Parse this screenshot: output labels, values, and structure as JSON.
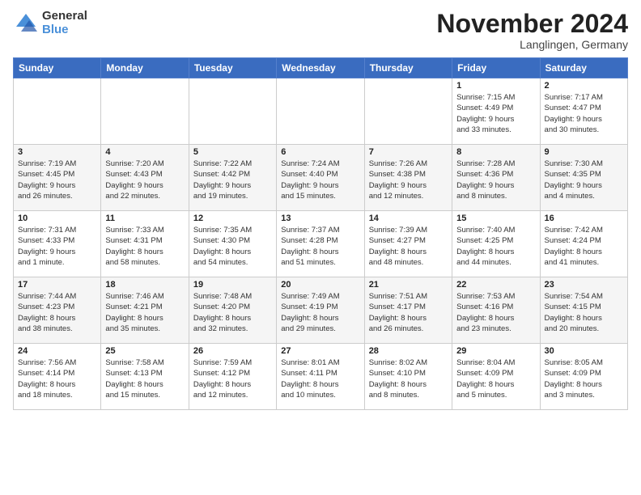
{
  "logo": {
    "general": "General",
    "blue": "Blue"
  },
  "title": "November 2024",
  "location": "Langlingen, Germany",
  "days_header": [
    "Sunday",
    "Monday",
    "Tuesday",
    "Wednesday",
    "Thursday",
    "Friday",
    "Saturday"
  ],
  "weeks": [
    [
      {
        "day": "",
        "info": ""
      },
      {
        "day": "",
        "info": ""
      },
      {
        "day": "",
        "info": ""
      },
      {
        "day": "",
        "info": ""
      },
      {
        "day": "",
        "info": ""
      },
      {
        "day": "1",
        "info": "Sunrise: 7:15 AM\nSunset: 4:49 PM\nDaylight: 9 hours\nand 33 minutes."
      },
      {
        "day": "2",
        "info": "Sunrise: 7:17 AM\nSunset: 4:47 PM\nDaylight: 9 hours\nand 30 minutes."
      }
    ],
    [
      {
        "day": "3",
        "info": "Sunrise: 7:19 AM\nSunset: 4:45 PM\nDaylight: 9 hours\nand 26 minutes."
      },
      {
        "day": "4",
        "info": "Sunrise: 7:20 AM\nSunset: 4:43 PM\nDaylight: 9 hours\nand 22 minutes."
      },
      {
        "day": "5",
        "info": "Sunrise: 7:22 AM\nSunset: 4:42 PM\nDaylight: 9 hours\nand 19 minutes."
      },
      {
        "day": "6",
        "info": "Sunrise: 7:24 AM\nSunset: 4:40 PM\nDaylight: 9 hours\nand 15 minutes."
      },
      {
        "day": "7",
        "info": "Sunrise: 7:26 AM\nSunset: 4:38 PM\nDaylight: 9 hours\nand 12 minutes."
      },
      {
        "day": "8",
        "info": "Sunrise: 7:28 AM\nSunset: 4:36 PM\nDaylight: 9 hours\nand 8 minutes."
      },
      {
        "day": "9",
        "info": "Sunrise: 7:30 AM\nSunset: 4:35 PM\nDaylight: 9 hours\nand 4 minutes."
      }
    ],
    [
      {
        "day": "10",
        "info": "Sunrise: 7:31 AM\nSunset: 4:33 PM\nDaylight: 9 hours\nand 1 minute."
      },
      {
        "day": "11",
        "info": "Sunrise: 7:33 AM\nSunset: 4:31 PM\nDaylight: 8 hours\nand 58 minutes."
      },
      {
        "day": "12",
        "info": "Sunrise: 7:35 AM\nSunset: 4:30 PM\nDaylight: 8 hours\nand 54 minutes."
      },
      {
        "day": "13",
        "info": "Sunrise: 7:37 AM\nSunset: 4:28 PM\nDaylight: 8 hours\nand 51 minutes."
      },
      {
        "day": "14",
        "info": "Sunrise: 7:39 AM\nSunset: 4:27 PM\nDaylight: 8 hours\nand 48 minutes."
      },
      {
        "day": "15",
        "info": "Sunrise: 7:40 AM\nSunset: 4:25 PM\nDaylight: 8 hours\nand 44 minutes."
      },
      {
        "day": "16",
        "info": "Sunrise: 7:42 AM\nSunset: 4:24 PM\nDaylight: 8 hours\nand 41 minutes."
      }
    ],
    [
      {
        "day": "17",
        "info": "Sunrise: 7:44 AM\nSunset: 4:23 PM\nDaylight: 8 hours\nand 38 minutes."
      },
      {
        "day": "18",
        "info": "Sunrise: 7:46 AM\nSunset: 4:21 PM\nDaylight: 8 hours\nand 35 minutes."
      },
      {
        "day": "19",
        "info": "Sunrise: 7:48 AM\nSunset: 4:20 PM\nDaylight: 8 hours\nand 32 minutes."
      },
      {
        "day": "20",
        "info": "Sunrise: 7:49 AM\nSunset: 4:19 PM\nDaylight: 8 hours\nand 29 minutes."
      },
      {
        "day": "21",
        "info": "Sunrise: 7:51 AM\nSunset: 4:17 PM\nDaylight: 8 hours\nand 26 minutes."
      },
      {
        "day": "22",
        "info": "Sunrise: 7:53 AM\nSunset: 4:16 PM\nDaylight: 8 hours\nand 23 minutes."
      },
      {
        "day": "23",
        "info": "Sunrise: 7:54 AM\nSunset: 4:15 PM\nDaylight: 8 hours\nand 20 minutes."
      }
    ],
    [
      {
        "day": "24",
        "info": "Sunrise: 7:56 AM\nSunset: 4:14 PM\nDaylight: 8 hours\nand 18 minutes."
      },
      {
        "day": "25",
        "info": "Sunrise: 7:58 AM\nSunset: 4:13 PM\nDaylight: 8 hours\nand 15 minutes."
      },
      {
        "day": "26",
        "info": "Sunrise: 7:59 AM\nSunset: 4:12 PM\nDaylight: 8 hours\nand 12 minutes."
      },
      {
        "day": "27",
        "info": "Sunrise: 8:01 AM\nSunset: 4:11 PM\nDaylight: 8 hours\nand 10 minutes."
      },
      {
        "day": "28",
        "info": "Sunrise: 8:02 AM\nSunset: 4:10 PM\nDaylight: 8 hours\nand 8 minutes."
      },
      {
        "day": "29",
        "info": "Sunrise: 8:04 AM\nSunset: 4:09 PM\nDaylight: 8 hours\nand 5 minutes."
      },
      {
        "day": "30",
        "info": "Sunrise: 8:05 AM\nSunset: 4:09 PM\nDaylight: 8 hours\nand 3 minutes."
      }
    ]
  ]
}
